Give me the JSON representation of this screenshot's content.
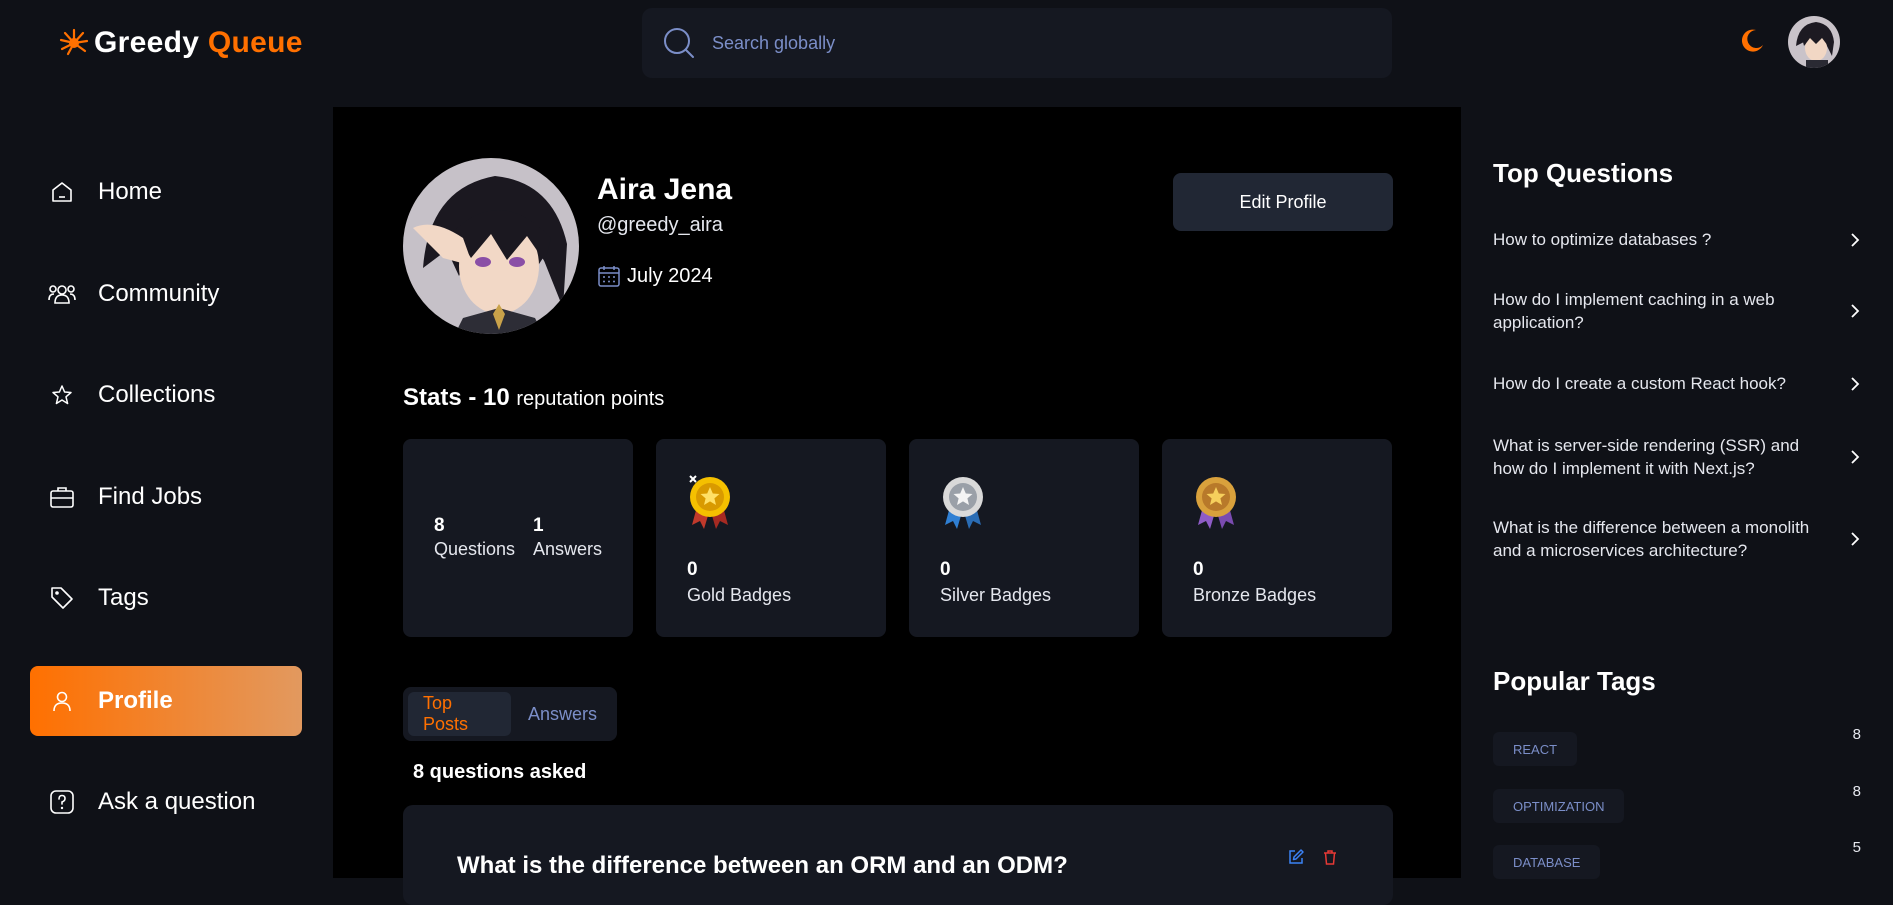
{
  "header": {
    "logo_part1": "Greedy",
    "logo_part2": "Queue",
    "search_placeholder": "Search globally",
    "accent_color": "#ff7000"
  },
  "sidebar": {
    "items": [
      {
        "label": "Home",
        "icon": "home-icon"
      },
      {
        "label": "Community",
        "icon": "users-icon"
      },
      {
        "label": "Collections",
        "icon": "star-icon"
      },
      {
        "label": "Find Jobs",
        "icon": "suitcase-icon"
      },
      {
        "label": "Tags",
        "icon": "tag-icon"
      },
      {
        "label": "Profile",
        "icon": "user-icon",
        "active": true
      },
      {
        "label": "Ask a question",
        "icon": "question-icon"
      }
    ]
  },
  "profile": {
    "name": "Aira Jena",
    "handle": "@greedy_aira",
    "joined": "July 2024",
    "edit_label": "Edit Profile"
  },
  "stats": {
    "title": "Stats - 10",
    "subtitle": "reputation points",
    "questions_count": "8",
    "questions_label": "Questions",
    "answers_count": "1",
    "answers_label": "Answers",
    "badges": [
      {
        "count": "0",
        "label": "Gold Badges",
        "icon": "gold-medal-icon"
      },
      {
        "count": "0",
        "label": "Silver Badges",
        "icon": "silver-medal-icon"
      },
      {
        "count": "0",
        "label": "Bronze Badges",
        "icon": "bronze-medal-icon"
      }
    ]
  },
  "tabs": {
    "top_posts": "Top Posts",
    "answers": "Answers"
  },
  "questions_asked": "8 questions asked",
  "post": {
    "title": "What is the difference between an ORM and an ODM?"
  },
  "right": {
    "top_questions_title": "Top Questions",
    "top_questions": [
      "How to optimize databases ?",
      "How do I implement caching in a web application?",
      "How do I create a custom React hook?",
      "What is server-side rendering (SSR) and how do I implement it with Next.js?",
      "What is the difference between a monolith and a microservices architecture?"
    ],
    "popular_tags_title": "Popular Tags",
    "tags": [
      {
        "name": "REACT",
        "count": "8"
      },
      {
        "name": "OPTIMIZATION",
        "count": "8"
      },
      {
        "name": "DATABASE",
        "count": "5"
      }
    ]
  }
}
